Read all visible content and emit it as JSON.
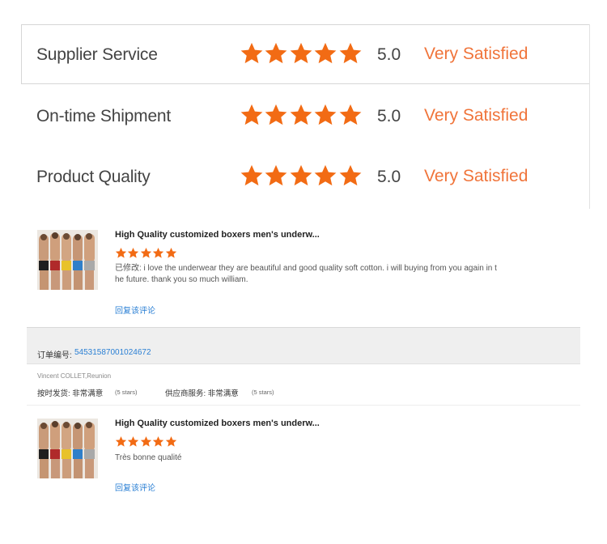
{
  "ratings": [
    {
      "label": "Supplier Service",
      "stars": 5,
      "score": "5.0",
      "text": "Very Satisfied"
    },
    {
      "label": "On-time Shipment",
      "stars": 5,
      "score": "5.0",
      "text": "Very Satisfied"
    },
    {
      "label": "Product Quality",
      "stars": 5,
      "score": "5.0",
      "text": "Very Satisfied"
    }
  ],
  "colors": {
    "star": "#f26b14",
    "accent_text": "#f0743a",
    "link": "#2a7fd4"
  },
  "reviews": [
    {
      "title": "High Quality customized boxers men's underw...",
      "stars": 5,
      "text_line1": "已修改: i love the underwear they are beautiful and good quality soft cotton. i will buying from you again in t",
      "text_line2": "he future. thank you so much william.",
      "reply_label": "回复该评论"
    },
    {
      "title": "High Quality customized boxers men's underw...",
      "stars": 5,
      "text_line1": "Très bonne qualité",
      "reply_label": "回复该评论"
    }
  ],
  "order": {
    "label": "订单编号:",
    "number": "54531587001024672",
    "buyer": "Vincent COLLET,Reunion",
    "shipping_label": "按时发货: 非常满意",
    "shipping_stars": "(5 stars)",
    "service_label": "供应商服务: 非常满意",
    "service_stars": "(5 stars)"
  }
}
